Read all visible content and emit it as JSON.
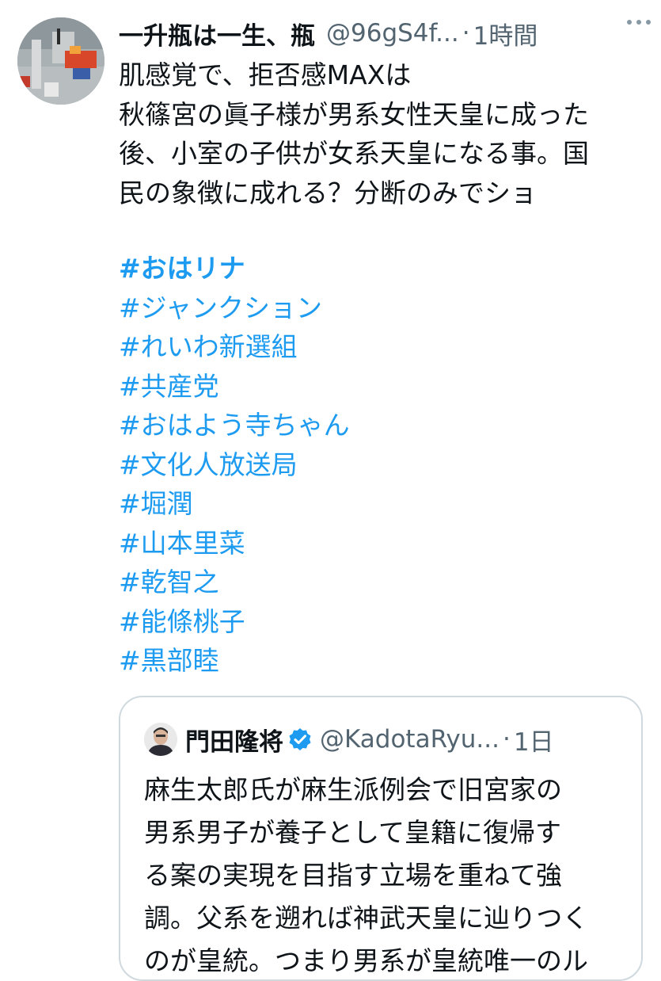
{
  "tweet": {
    "display_name": "一升瓶は一生、瓶",
    "handle": "@96gS4f...",
    "separator": "·",
    "time": "1時間",
    "avatar_icon": "avatar-image",
    "more_icon": "more-options-icon",
    "body_lines": [
      "肌感覚で、拒否感MAXは",
      "秋篠宮の眞子様が男系女性天皇に成った",
      "後、小室の子供が女系天皇になる事。国",
      "民の象徴に成れる？分断のみでショ"
    ],
    "hashtags": [
      "#おはリナ",
      "#ジャンクション",
      "#れいわ新選組",
      "#共産党",
      "#おはよう寺ちゃん",
      "#文化人放送局",
      "#堀潤",
      "#山本里菜",
      "#乾智之",
      "#能條桃子",
      "#黒部睦"
    ],
    "hashtag_color": "#1d9bf0"
  },
  "quote": {
    "display_name": "門田隆将",
    "verified_icon": "verified-badge-icon",
    "handle": "@KadotaRyu...",
    "separator": "·",
    "time": "1日",
    "text_lines": [
      "麻生太郎氏が麻生派例会で旧宮家の",
      "男系男子が養子として皇籍に復帰す",
      "る案の実現を目指す立場を重ねて強",
      "調。父系を遡れば神武天皇に辿りつく",
      "のが皇統。つまり男系が皇統唯一のル"
    ]
  }
}
